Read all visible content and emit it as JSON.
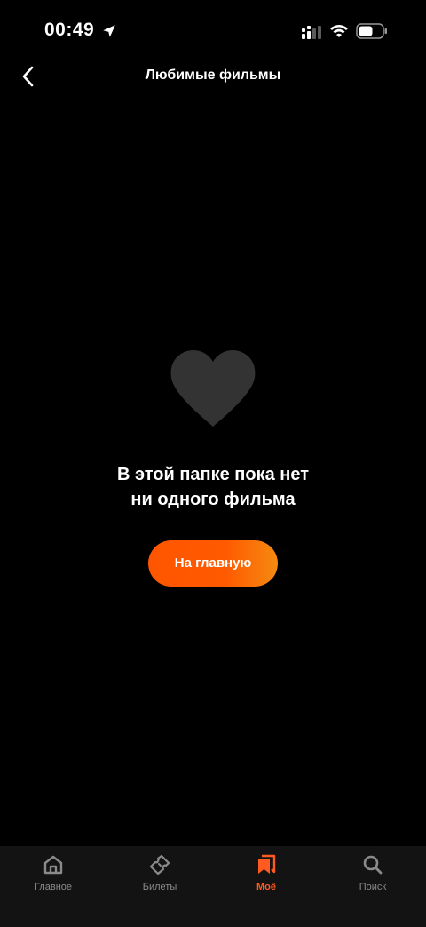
{
  "status_bar": {
    "time": "00:49"
  },
  "header": {
    "title": "Любимые фильмы"
  },
  "empty_state": {
    "line1": "В этой папке пока нет",
    "line2": "ни одного фильма",
    "button_label": "На главную"
  },
  "tabs": [
    {
      "label": "Главное",
      "icon": "home-icon",
      "active": false
    },
    {
      "label": "Билеты",
      "icon": "ticket-icon",
      "active": false
    },
    {
      "label": "Моё",
      "icon": "bookmarks-icon",
      "active": true
    },
    {
      "label": "Поиск",
      "icon": "search-icon",
      "active": false
    }
  ],
  "colors": {
    "background": "#000000",
    "accent": "#ff5a1f",
    "heart": "#333333",
    "tab_bar": "#131313",
    "tab_inactive": "#8a8a8a"
  }
}
